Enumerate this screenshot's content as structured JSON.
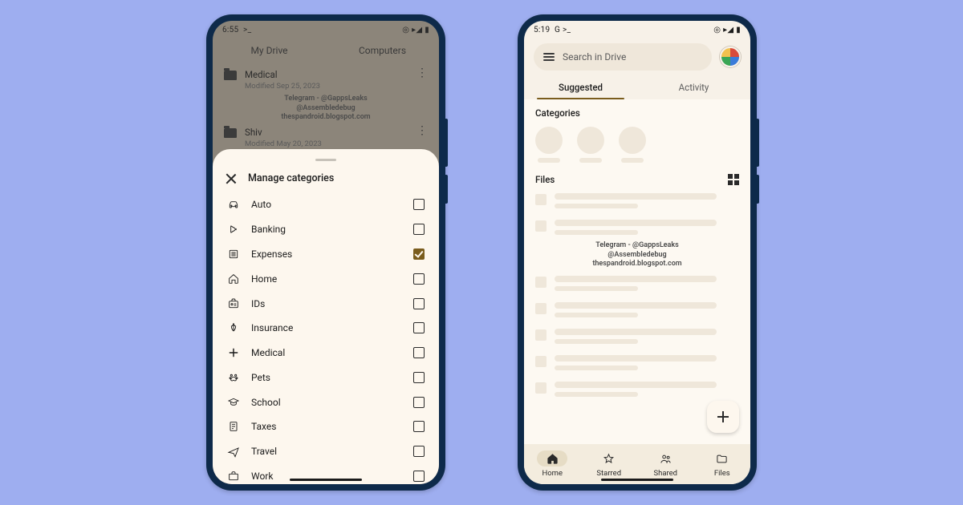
{
  "left": {
    "status_time": "6:55",
    "status_prompt": ">_",
    "tabs": {
      "my_drive": "My Drive",
      "computers": "Computers"
    },
    "folders": [
      {
        "title": "Medical",
        "sub": "Modified Sep 25, 2023"
      },
      {
        "title": "Shiv",
        "sub": "Modified May 20, 2023"
      }
    ],
    "watermark": {
      "l1": "Telegram - @GappsLeaks",
      "l2": "@Assembledebug",
      "l3": "thespandroid.blogspot.com"
    },
    "sheet_title": "Manage categories",
    "categories": [
      {
        "label": "Auto",
        "checked": false,
        "icon": "auto"
      },
      {
        "label": "Banking",
        "checked": false,
        "icon": "banking"
      },
      {
        "label": "Expenses",
        "checked": true,
        "icon": "expenses"
      },
      {
        "label": "Home",
        "checked": false,
        "icon": "home"
      },
      {
        "label": "IDs",
        "checked": false,
        "icon": "ids"
      },
      {
        "label": "Insurance",
        "checked": false,
        "icon": "insurance"
      },
      {
        "label": "Medical",
        "checked": false,
        "icon": "medical"
      },
      {
        "label": "Pets",
        "checked": false,
        "icon": "pets"
      },
      {
        "label": "School",
        "checked": false,
        "icon": "school"
      },
      {
        "label": "Taxes",
        "checked": false,
        "icon": "taxes"
      },
      {
        "label": "Travel",
        "checked": false,
        "icon": "travel"
      },
      {
        "label": "Work",
        "checked": false,
        "icon": "work"
      }
    ]
  },
  "right": {
    "status_time": "5:19",
    "status_prompt": "G  >_",
    "search_placeholder": "Search in Drive",
    "tabs": {
      "suggested": "Suggested",
      "activity": "Activity"
    },
    "categories_label": "Categories",
    "files_label": "Files",
    "watermark": {
      "l1": "Telegram - @GappsLeaks",
      "l2": "@Assembledebug",
      "l3": "thespandroid.blogspot.com"
    },
    "nav": {
      "home": "Home",
      "starred": "Starred",
      "shared": "Shared",
      "files": "Files"
    }
  }
}
